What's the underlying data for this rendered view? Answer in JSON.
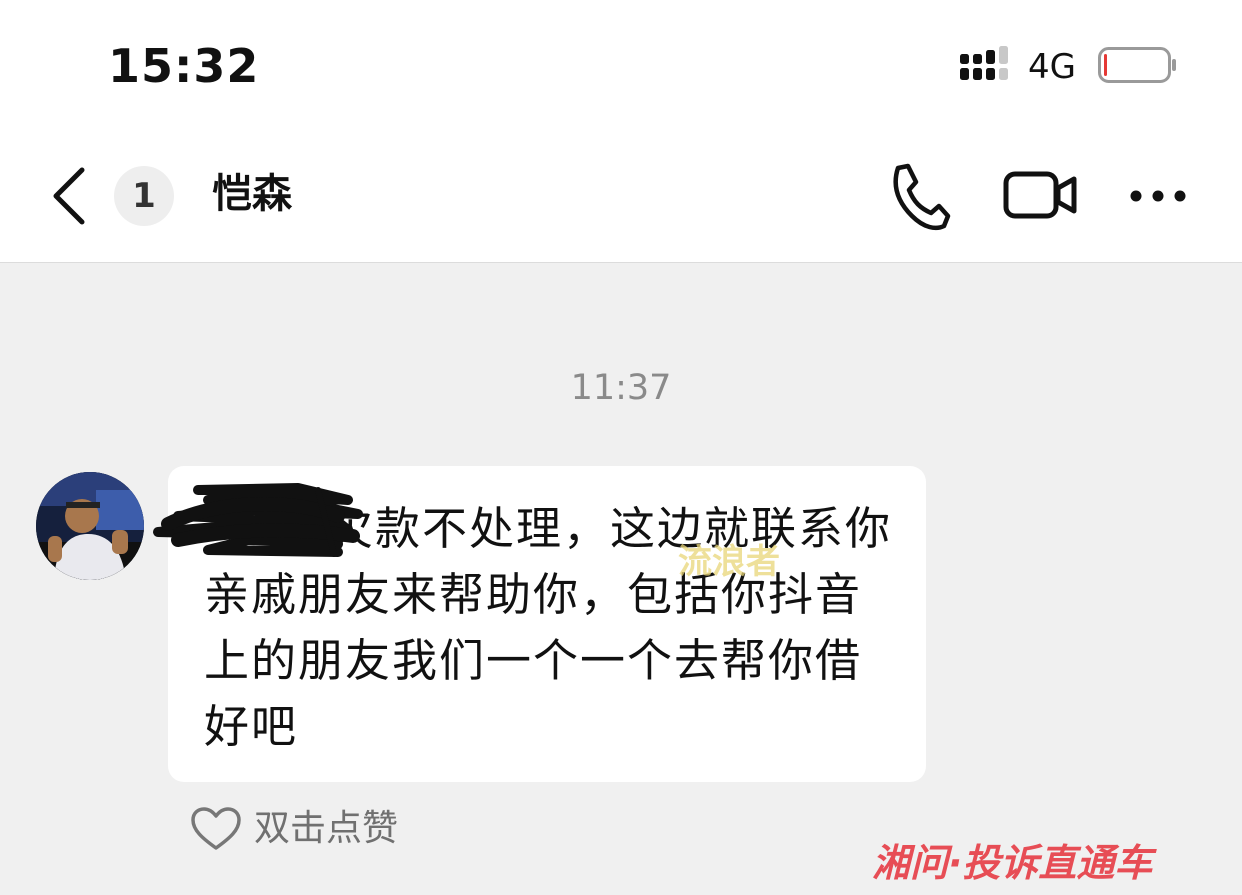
{
  "status_bar": {
    "time": "15:32",
    "network": "4G",
    "battery_level": 0.05,
    "signal_icon": "signal-bars-icon",
    "battery_icon": "battery-low-icon"
  },
  "header": {
    "back_icon": "chevron-left-icon",
    "unread_count": "1",
    "contact_name": "恺森",
    "call_icon": "phone-icon",
    "video_icon": "video-camera-icon",
    "more_icon": "more-horizontal-icon"
  },
  "chat": {
    "timestamp": "11:37",
    "message": {
      "text": "欠款不处理，这边就联系你亲戚朋友来帮助你，包括你抖音上的朋友我们一个一个去帮你借好吧",
      "redacted_prefix": true
    },
    "like_label": "双击点赞",
    "like_icon": "heart-outline-icon"
  },
  "watermarks": {
    "center": "流浪者",
    "corner": "湘问·投诉直通车"
  },
  "colors": {
    "background": "#f0f0f0",
    "bubble": "#ffffff",
    "battery_low": "#e53935",
    "watermark_red": "#e42832"
  }
}
